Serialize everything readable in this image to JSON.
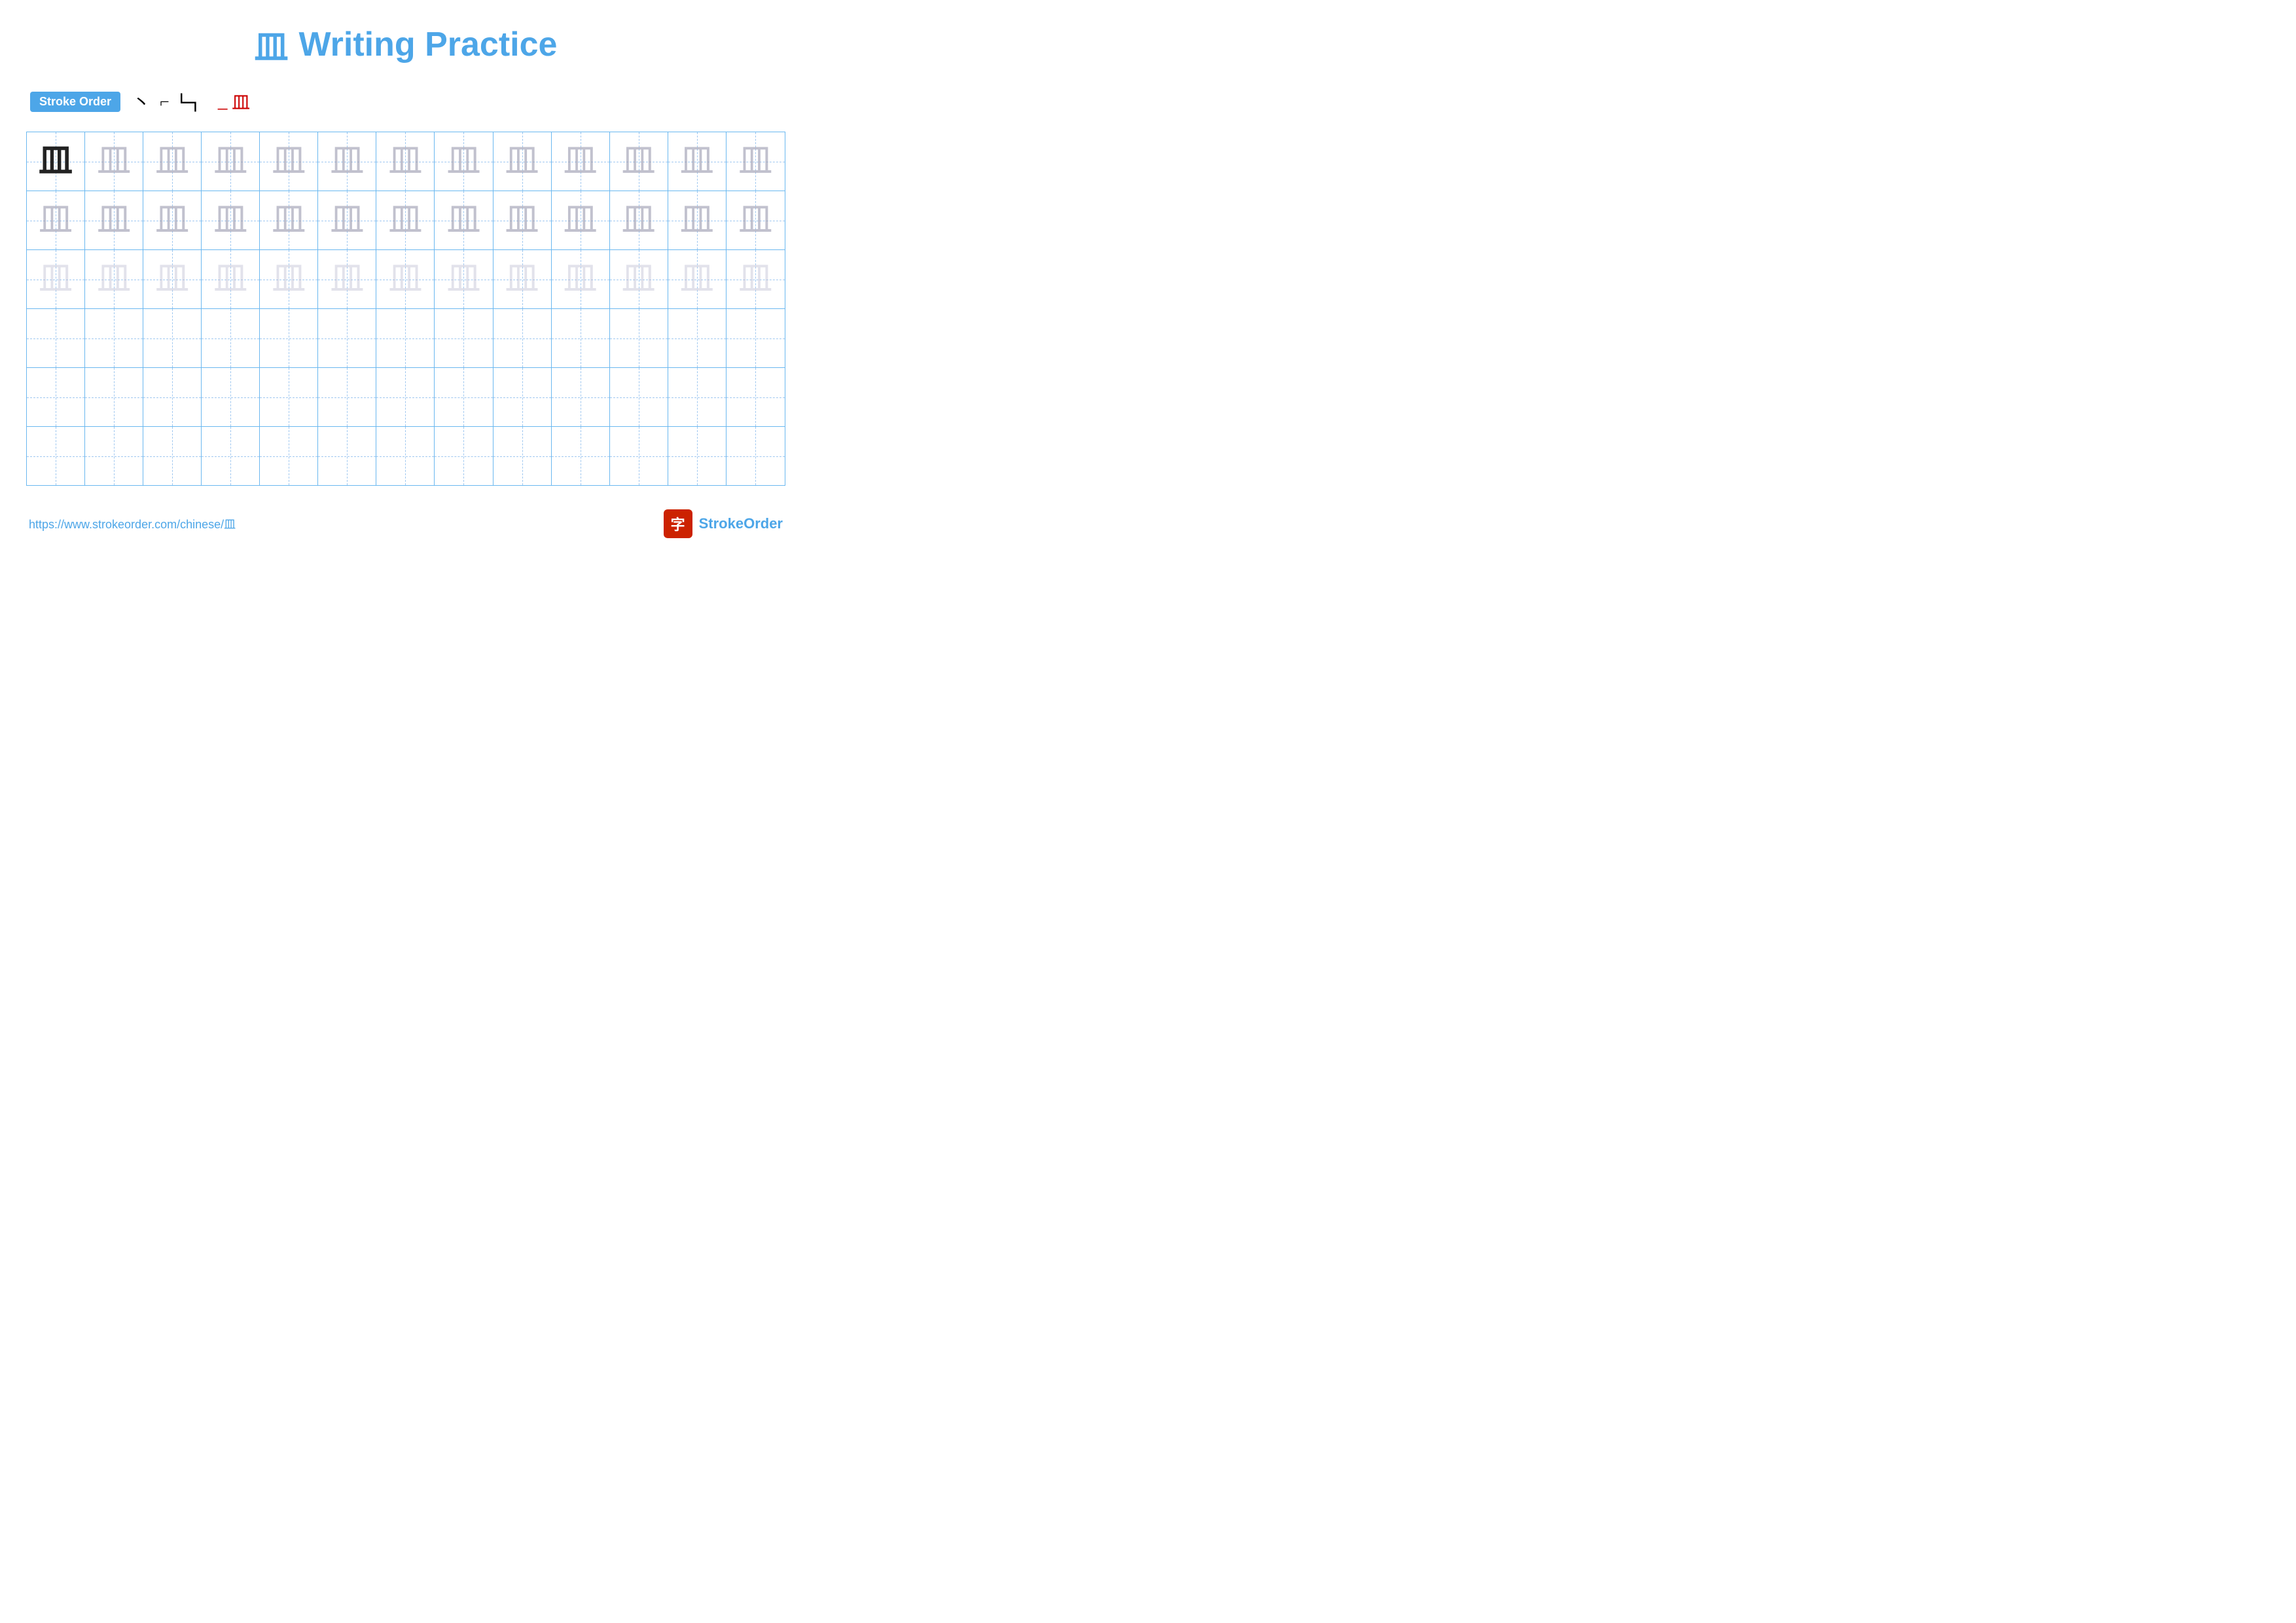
{
  "title": {
    "char": "皿",
    "text": "Writing Practice"
  },
  "stroke_order": {
    "badge_label": "Stroke Order",
    "steps": [
      "丶",
      "⌐",
      "㎜",
      "皿̲",
      "皿"
    ]
  },
  "grid": {
    "rows": 6,
    "cols": 13,
    "char": "皿",
    "row_types": [
      "solid-then-ghost",
      "ghost",
      "ghost-lighter",
      "empty",
      "empty",
      "empty"
    ]
  },
  "footer": {
    "url": "https://www.strokeorder.com/chinese/皿",
    "brand_icon": "字",
    "brand_name": "StrokeOrder"
  }
}
